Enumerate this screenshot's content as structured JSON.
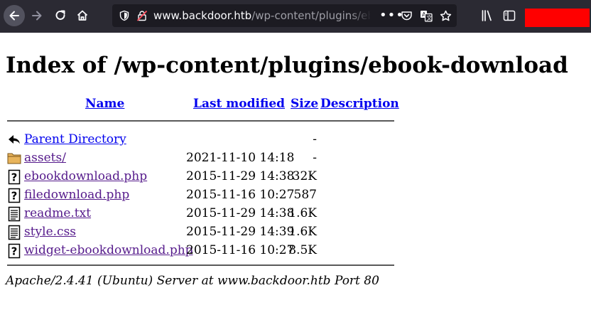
{
  "browser": {
    "url_domain": "www.backdoor.htb",
    "url_path": "/wp-content/plugins/eboo",
    "more_label": "•••",
    "icons": [
      "back-icon",
      "forward-icon",
      "reload-icon",
      "home-icon",
      "shield-icon",
      "insecure-lock-icon",
      "pocket-icon",
      "translate-icon",
      "bookmark-star-icon",
      "library-icon",
      "sidebar-icon"
    ],
    "colors": {
      "toolbar": "#2b2a33",
      "urlbar": "#1c1b22",
      "redacted_account": "#ff0000"
    }
  },
  "page": {
    "title": "Index of /wp-content/plugins/ebook-download",
    "columns": {
      "name": "Name",
      "modified": "Last modified",
      "size": "Size",
      "description": "Description"
    },
    "rows": [
      {
        "icon": "back-icon",
        "name": "Parent Directory",
        "modified": "",
        "size": "-",
        "visited": false
      },
      {
        "icon": "folder-icon",
        "name": "assets/",
        "modified": "2021-11-10 14:18",
        "size": "-",
        "visited": true
      },
      {
        "icon": "unknown-file-icon",
        "name": "ebookdownload.php",
        "modified": "2015-11-29 14:38",
        "size": "32K",
        "visited": true
      },
      {
        "icon": "unknown-file-icon",
        "name": "filedownload.php",
        "modified": "2015-11-16 10:27",
        "size": "587",
        "visited": true
      },
      {
        "icon": "text-file-icon",
        "name": "readme.txt",
        "modified": "2015-11-29 14:38",
        "size": "1.6K",
        "visited": true
      },
      {
        "icon": "text-file-icon",
        "name": "style.css",
        "modified": "2015-11-29 14:39",
        "size": "1.6K",
        "visited": true
      },
      {
        "icon": "unknown-file-icon",
        "name": "widget-ebookdownload.php",
        "modified": "2015-11-16 10:27",
        "size": "8.5K",
        "visited": true
      }
    ],
    "footer": "Apache/2.4.41 (Ubuntu) Server at www.backdoor.htb Port 80",
    "colors": {
      "link": "#0000ee",
      "visited_link": "#551a8b"
    }
  }
}
